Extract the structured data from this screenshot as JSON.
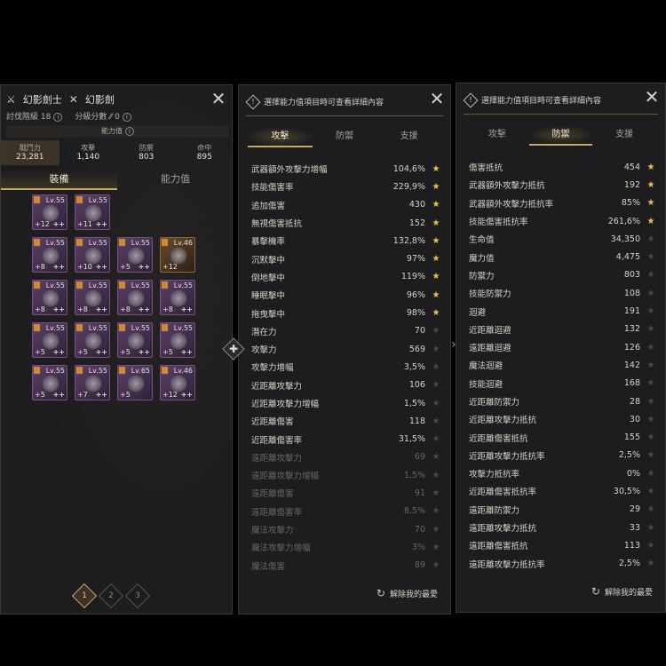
{
  "panel1": {
    "class_name": "幻影劍士",
    "weapon_name": "幻影劍",
    "hunt_level_label": "討伐階級",
    "hunt_level_value": "18",
    "class_score_label": "分級分數",
    "class_score_value": "0",
    "ability_label": "能力值",
    "stats": [
      {
        "label": "戰鬥力",
        "value": "23,281"
      },
      {
        "label": "攻擊",
        "value": "1,140"
      },
      {
        "label": "防禦",
        "value": "803"
      },
      {
        "label": "命中",
        "value": "895"
      }
    ],
    "tabs": [
      "裝備",
      "能力值"
    ],
    "items": [
      {
        "lv": "Lv.55",
        "enh": "+12",
        "pp": "++"
      },
      {
        "lv": "Lv.55",
        "enh": "+11",
        "pp": "++"
      },
      {
        "lv": "Lv.55",
        "enh": "+8",
        "pp": "++"
      },
      {
        "lv": "Lv.55",
        "enh": "+10",
        "pp": "++"
      },
      {
        "lv": "Lv.55",
        "enh": "+5",
        "pp": "++"
      },
      {
        "lv": "Lv.46",
        "enh": "+12",
        "pp": ""
      },
      {
        "lv": "Lv.55",
        "enh": "+8",
        "pp": "++"
      },
      {
        "lv": "Lv.55",
        "enh": "+8",
        "pp": "++"
      },
      {
        "lv": "Lv.55",
        "enh": "+8",
        "pp": "++"
      },
      {
        "lv": "Lv.55",
        "enh": "+8",
        "pp": "++"
      },
      {
        "lv": "Lv.55",
        "enh": "+5",
        "pp": "++"
      },
      {
        "lv": "Lv.55",
        "enh": "+5",
        "pp": "++"
      },
      {
        "lv": "Lv.55",
        "enh": "+5",
        "pp": "++"
      },
      {
        "lv": "Lv.55",
        "enh": "+5",
        "pp": "++"
      },
      {
        "lv": "Lv.55",
        "enh": "+5",
        "pp": "++"
      },
      {
        "lv": "Lv.55",
        "enh": "+7",
        "pp": "++"
      },
      {
        "lv": "Lv.65",
        "enh": "+5",
        "pp": ""
      },
      {
        "lv": "Lv.46",
        "enh": "+12",
        "pp": "++"
      }
    ],
    "pages": [
      "1",
      "2",
      "3"
    ]
  },
  "panel2": {
    "hint": "選擇能力值項目時可查看詳細內容",
    "tabs": [
      "攻擊",
      "防禦",
      "支援"
    ],
    "reset_label": "解除我的最愛",
    "rows": [
      {
        "label": "武器額外攻擊力增幅",
        "value": "104,6%",
        "star": true
      },
      {
        "label": "技能傷害率",
        "value": "229,9%",
        "star": true
      },
      {
        "label": "追加傷害",
        "value": "430",
        "star": true
      },
      {
        "label": "無視傷害抵抗",
        "value": "152",
        "star": true
      },
      {
        "label": "暴擊機率",
        "value": "132,8%",
        "star": true
      },
      {
        "label": "沉默擊中",
        "value": "97%",
        "star": true
      },
      {
        "label": "倒地擊中",
        "value": "119%",
        "star": true
      },
      {
        "label": "睡眠擊中",
        "value": "96%",
        "star": true
      },
      {
        "label": "拖曳擊中",
        "value": "98%",
        "star": true
      },
      {
        "label": "潛在力",
        "value": "70",
        "star": false
      },
      {
        "label": "攻擊力",
        "value": "569",
        "star": false
      },
      {
        "label": "攻擊力增幅",
        "value": "3,5%",
        "star": false
      },
      {
        "label": "近距離攻擊力",
        "value": "106",
        "star": false
      },
      {
        "label": "近距離攻擊力增幅",
        "value": "1,5%",
        "star": false
      },
      {
        "label": "近距離傷害",
        "value": "118",
        "star": false
      },
      {
        "label": "近距離傷害率",
        "value": "31,5%",
        "star": false
      },
      {
        "label": "遠距離攻擊力",
        "value": "69",
        "star": false,
        "dim": true
      },
      {
        "label": "遠距離攻擊力增幅",
        "value": "1,5%",
        "star": false,
        "dim": true
      },
      {
        "label": "遠距離傷害",
        "value": "91",
        "star": false,
        "dim": true
      },
      {
        "label": "遠距離傷害率",
        "value": "8,5%",
        "star": false,
        "dim": true
      },
      {
        "label": "魔法攻擊力",
        "value": "70",
        "star": false,
        "dim": true
      },
      {
        "label": "魔法攻擊力增幅",
        "value": "3%",
        "star": false,
        "dim": true
      },
      {
        "label": "魔法傷害",
        "value": "89",
        "star": false,
        "dim": true
      }
    ]
  },
  "panel3": {
    "hint": "選擇能力值項目時可查看詳細內容",
    "tabs": [
      "攻擊",
      "防禦",
      "支援"
    ],
    "reset_label": "解除我的最愛",
    "rows": [
      {
        "label": "傷害抵抗",
        "value": "454",
        "star": true
      },
      {
        "label": "武器額外攻擊力抵抗",
        "value": "192",
        "star": true
      },
      {
        "label": "武器額外攻擊力抵抗率",
        "value": "85%",
        "star": true
      },
      {
        "label": "技能傷害抵抗率",
        "value": "261,6%",
        "star": true
      },
      {
        "label": "生命值",
        "value": "34,350",
        "star": false
      },
      {
        "label": "魔力值",
        "value": "4,475",
        "star": false
      },
      {
        "label": "防禦力",
        "value": "803",
        "star": false
      },
      {
        "label": "技能防禦力",
        "value": "108",
        "star": false
      },
      {
        "label": "迴避",
        "value": "191",
        "star": false
      },
      {
        "label": "近距離迴避",
        "value": "132",
        "star": false
      },
      {
        "label": "遠距離迴避",
        "value": "126",
        "star": false
      },
      {
        "label": "魔法迴避",
        "value": "142",
        "star": false
      },
      {
        "label": "技能迴避",
        "value": "168",
        "star": false
      },
      {
        "label": "近距離防禦力",
        "value": "28",
        "star": false
      },
      {
        "label": "近距離攻擊力抵抗",
        "value": "30",
        "star": false
      },
      {
        "label": "近距離傷害抵抗",
        "value": "155",
        "star": false
      },
      {
        "label": "近距離攻擊力抵抗率",
        "value": "2,5%",
        "star": false
      },
      {
        "label": "攻擊力抵抗率",
        "value": "0%",
        "star": false
      },
      {
        "label": "近距離傷害抵抗率",
        "value": "30,5%",
        "star": false
      },
      {
        "label": "遠距離防禦力",
        "value": "29",
        "star": false
      },
      {
        "label": "遠距離攻擊力抵抗",
        "value": "33",
        "star": false
      },
      {
        "label": "遠距離傷害抵抗",
        "value": "113",
        "star": false
      },
      {
        "label": "遠距離攻擊力抵抗率",
        "value": "2,5%",
        "star": false
      }
    ]
  }
}
